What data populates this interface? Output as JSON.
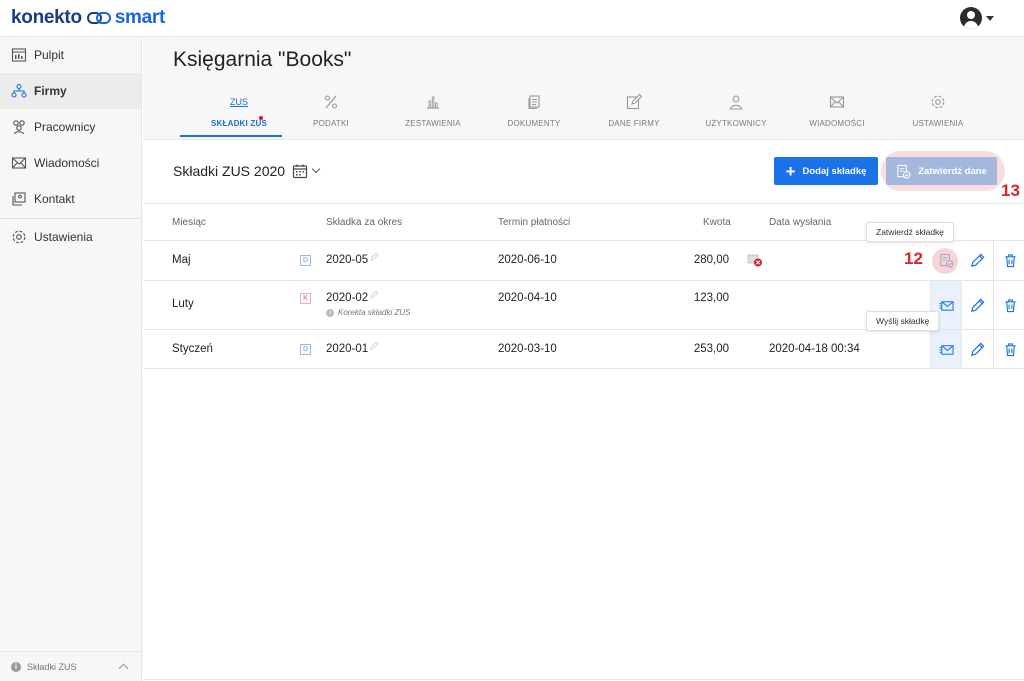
{
  "header": {
    "logo_part1": "konekto",
    "logo_part2": "smart"
  },
  "sidebar": {
    "items": [
      {
        "label": "Pulpit",
        "icon": "dashboard-icon"
      },
      {
        "label": "Firmy",
        "icon": "companies-icon"
      },
      {
        "label": "Pracownicy",
        "icon": "employees-icon"
      },
      {
        "label": "Wiadomości",
        "icon": "messages-icon"
      },
      {
        "label": "Kontakt",
        "icon": "contact-icon"
      },
      {
        "label": "Ustawienia",
        "icon": "settings-icon"
      }
    ],
    "footer_label": "Składki ZUS",
    "footer_info": "i"
  },
  "main": {
    "company_title": "Księgarnia \"Books\"",
    "tabs": [
      {
        "label": "SKŁADKI ZUS",
        "icon_text": "ZUS",
        "icon": "zus-icon"
      },
      {
        "label": "PODATKI",
        "icon": "percent-icon"
      },
      {
        "label": "ZESTAWIENIA",
        "icon": "bar-chart-icon"
      },
      {
        "label": "DOKUMENTY",
        "icon": "documents-icon"
      },
      {
        "label": "DANE FIRMY",
        "icon": "edit-icon"
      },
      {
        "label": "UŻYTKOWNICY",
        "icon": "users-icon"
      },
      {
        "label": "WIADOMOŚCI",
        "icon": "mail-icon"
      },
      {
        "label": "USTAWIENIA",
        "icon": "gear-icon"
      }
    ]
  },
  "toolbar": {
    "section_title": "Składki ZUS 2020",
    "add_button": "Dodaj składkę",
    "add_plus": "+",
    "confirm_button": "Zatwierdź dane",
    "annotation_13": "13",
    "annotation_12": "12"
  },
  "table": {
    "columns": [
      "Miesiąc",
      "Składka za okres",
      "Termin płatności",
      "Kwota",
      "Data wysłania"
    ],
    "rows": [
      {
        "month": "Maj",
        "badge": "D",
        "period": "2020-05",
        "due": "2020-06-10",
        "amount": "280,00",
        "sent": "",
        "note": ""
      },
      {
        "month": "Luty",
        "badge": "K",
        "period": "2020-02",
        "due": "2020-04-10",
        "amount": "123,00",
        "sent": "",
        "note": "Korekta składki ZUS"
      },
      {
        "month": "Styczeń",
        "badge": "D",
        "period": "2020-01",
        "due": "2020-03-10",
        "amount": "253,00",
        "sent": "2020-04-18 00:34",
        "note": ""
      }
    ],
    "tooltip_confirm": "Zatwierdź składkę",
    "tooltip_send": "Wyślij składkę",
    "note_info": "i"
  },
  "colors": {
    "accent": "#1a73e8",
    "annotation": "#d7262f",
    "disabled_button": "#a3b8dc"
  }
}
